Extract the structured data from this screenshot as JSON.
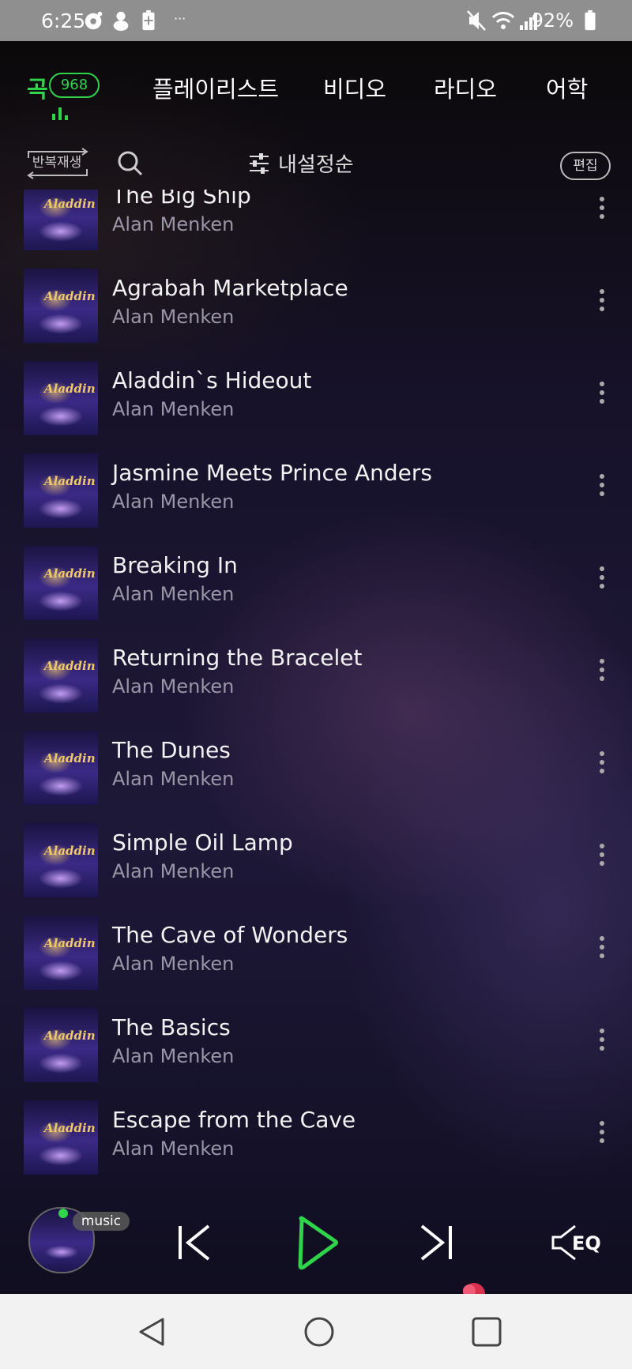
{
  "status_bar": {
    "time": "6:25",
    "battery": "92%"
  },
  "tabs": [
    {
      "label": "곡",
      "count": "968",
      "active": true
    },
    {
      "label": "플레이리스트"
    },
    {
      "label": "비디오"
    },
    {
      "label": "라디오"
    },
    {
      "label": "어학"
    }
  ],
  "toolbar": {
    "repeat_label": "반복재생",
    "sort_label": "내설정순",
    "edit_label": "편집"
  },
  "songs": [
    {
      "title": "The Big Ship",
      "artist": "Alan Menken"
    },
    {
      "title": "Agrabah Marketplace",
      "artist": "Alan Menken"
    },
    {
      "title": "Aladdin`s Hideout",
      "artist": "Alan Menken"
    },
    {
      "title": "Jasmine Meets Prince Anders",
      "artist": "Alan Menken"
    },
    {
      "title": "Breaking In",
      "artist": "Alan Menken"
    },
    {
      "title": "Returning the Bracelet",
      "artist": "Alan Menken"
    },
    {
      "title": "The Dunes",
      "artist": "Alan Menken"
    },
    {
      "title": "Simple Oil Lamp",
      "artist": "Alan Menken"
    },
    {
      "title": "The Cave of Wonders",
      "artist": "Alan Menken"
    },
    {
      "title": "The Basics",
      "artist": "Alan Menken"
    },
    {
      "title": "Escape from the Cave",
      "artist": "Alan Menken"
    }
  ],
  "album_logo": "Aladdin",
  "player": {
    "pill_label": "music",
    "eq_label": "EQ"
  },
  "colors": {
    "accent": "#2fd44a"
  },
  "icons": [
    "search-icon",
    "sort-sliders-icon",
    "more-vert-icon",
    "prev-icon",
    "play-icon",
    "next-icon",
    "eq-speaker-icon",
    "back-icon",
    "home-icon",
    "recents-icon"
  ]
}
